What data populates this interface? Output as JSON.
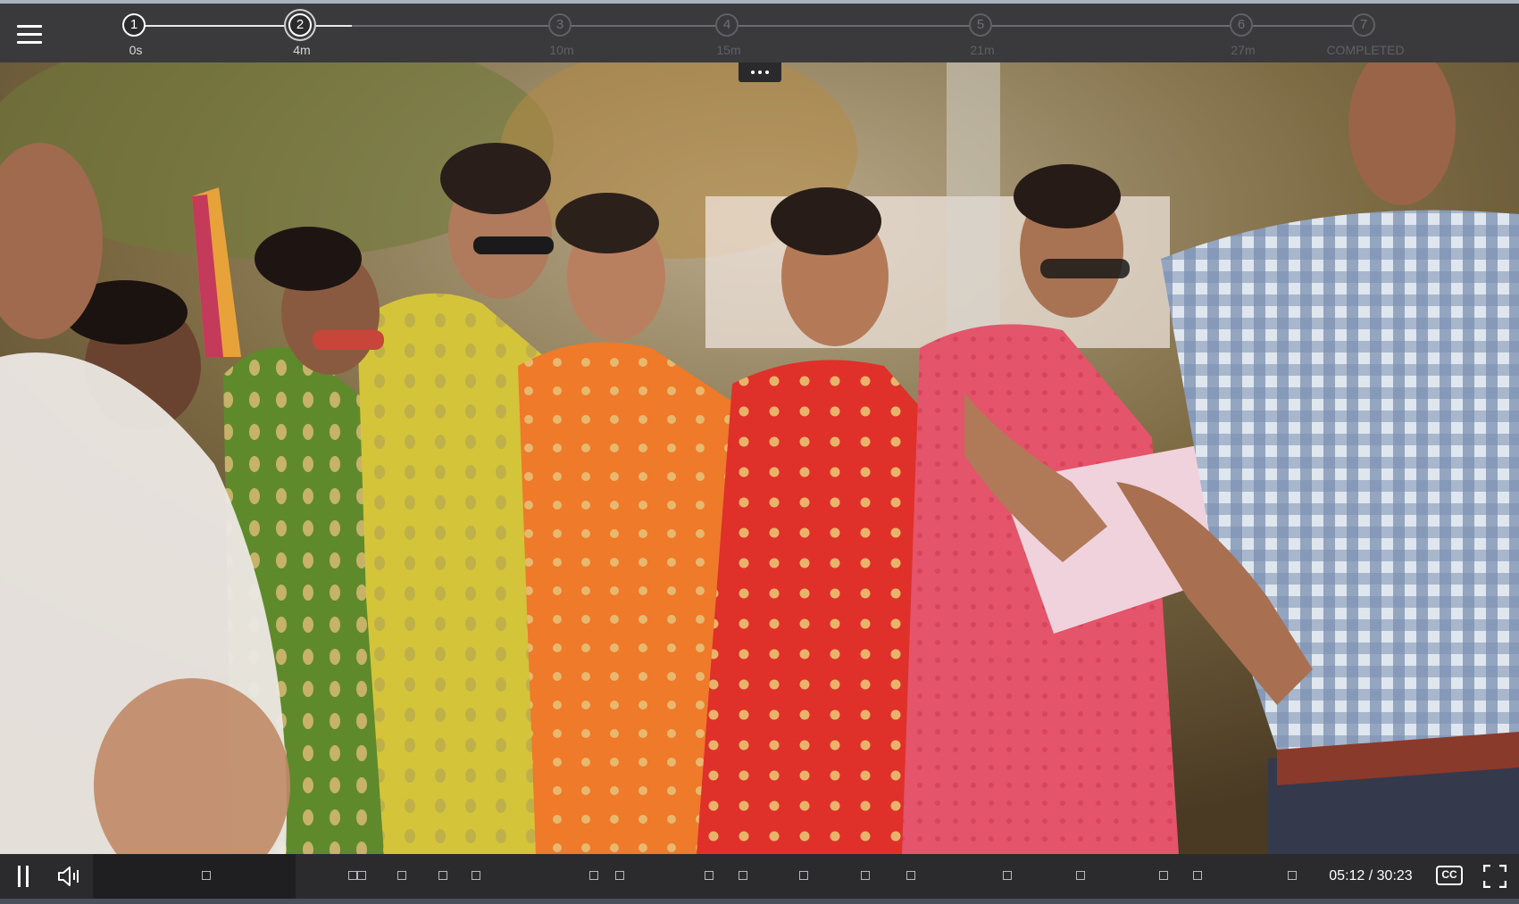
{
  "header": {
    "menu_icon": "hamburger-menu-icon",
    "milestones": [
      {
        "number": "1",
        "label": "0s",
        "status": "done"
      },
      {
        "number": "2",
        "label": "4m",
        "status": "current"
      },
      {
        "number": "3",
        "label": "10m",
        "status": "upcoming"
      },
      {
        "number": "4",
        "label": "15m",
        "status": "upcoming"
      },
      {
        "number": "5",
        "label": "21m",
        "status": "upcoming"
      },
      {
        "number": "6",
        "label": "27m",
        "status": "upcoming"
      },
      {
        "number": "7",
        "label": "COMPLETED",
        "status": "upcoming"
      }
    ]
  },
  "video": {
    "more_icon": "more-horizontal-icon"
  },
  "controls": {
    "pause_icon": "pause-icon",
    "volume_icon": "volume-icon",
    "current_time": "05:12",
    "duration": "30:23",
    "time_display": "05:12 / 30:23",
    "played_fraction": 0.171,
    "cc_label": "CC",
    "fullscreen_icon": "fullscreen-icon"
  },
  "colors": {
    "bar_background": "#3a3a3d",
    "accent_done": "#ffffff",
    "inactive": "#5f5f64"
  }
}
